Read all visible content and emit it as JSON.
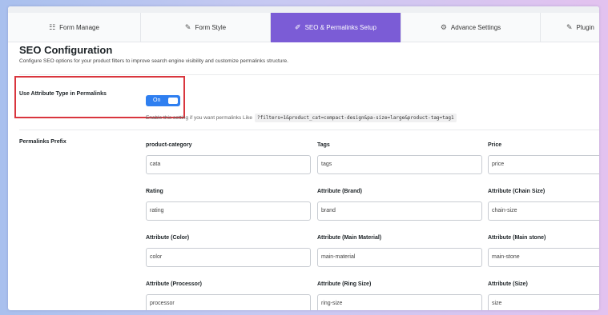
{
  "tabs": [
    {
      "label": "Form Manage",
      "icon": "sliders-icon",
      "glyph": "☷",
      "active": false
    },
    {
      "label": "Form Style",
      "icon": "brush-icon",
      "glyph": "✎",
      "active": false
    },
    {
      "label": "SEO & Permalinks Setup",
      "icon": "link-icon",
      "glyph": "✐",
      "active": true
    },
    {
      "label": "Advance Settings",
      "icon": "gear-icon",
      "glyph": "⚙",
      "active": false
    },
    {
      "label": "Plugin",
      "icon": "plug-icon",
      "glyph": "✎",
      "active": false
    }
  ],
  "accent_color": "#7b5cd6",
  "title": "SEO Configuration",
  "subtitle": "Configure SEO options for your product filters to improve search engine visibility and customize permalinks structure.",
  "attribute_setting": {
    "label": "Use Attribute Type in Permalinks",
    "toggle_text": "On",
    "hint": "Enable this setting if you want permalinks Like",
    "example": "?filters=1&product_cat=compact-design&pa-size=large&product-tag=tag1"
  },
  "permalinks_prefix": {
    "label": "Permalinks Prefix",
    "fields": [
      {
        "label": "product-category",
        "value": "cata"
      },
      {
        "label": "Tags",
        "value": "tags"
      },
      {
        "label": "Price",
        "value": "price"
      },
      {
        "label": "Rating",
        "value": "rating"
      },
      {
        "label": "Attribute (Brand)",
        "value": "brand"
      },
      {
        "label": "Attribute (Chain Size)",
        "value": "chain-size"
      },
      {
        "label": "Attribute (Color)",
        "value": "color"
      },
      {
        "label": "Attribute (Main Material)",
        "value": "main-material"
      },
      {
        "label": "Attribute (Main stone)",
        "value": "main-stone"
      },
      {
        "label": "Attribute (Processor)",
        "value": "processor"
      },
      {
        "label": "Attribute (Ring Size)",
        "value": "ring-size"
      },
      {
        "label": "Attribute (Size)",
        "value": "size"
      }
    ]
  }
}
